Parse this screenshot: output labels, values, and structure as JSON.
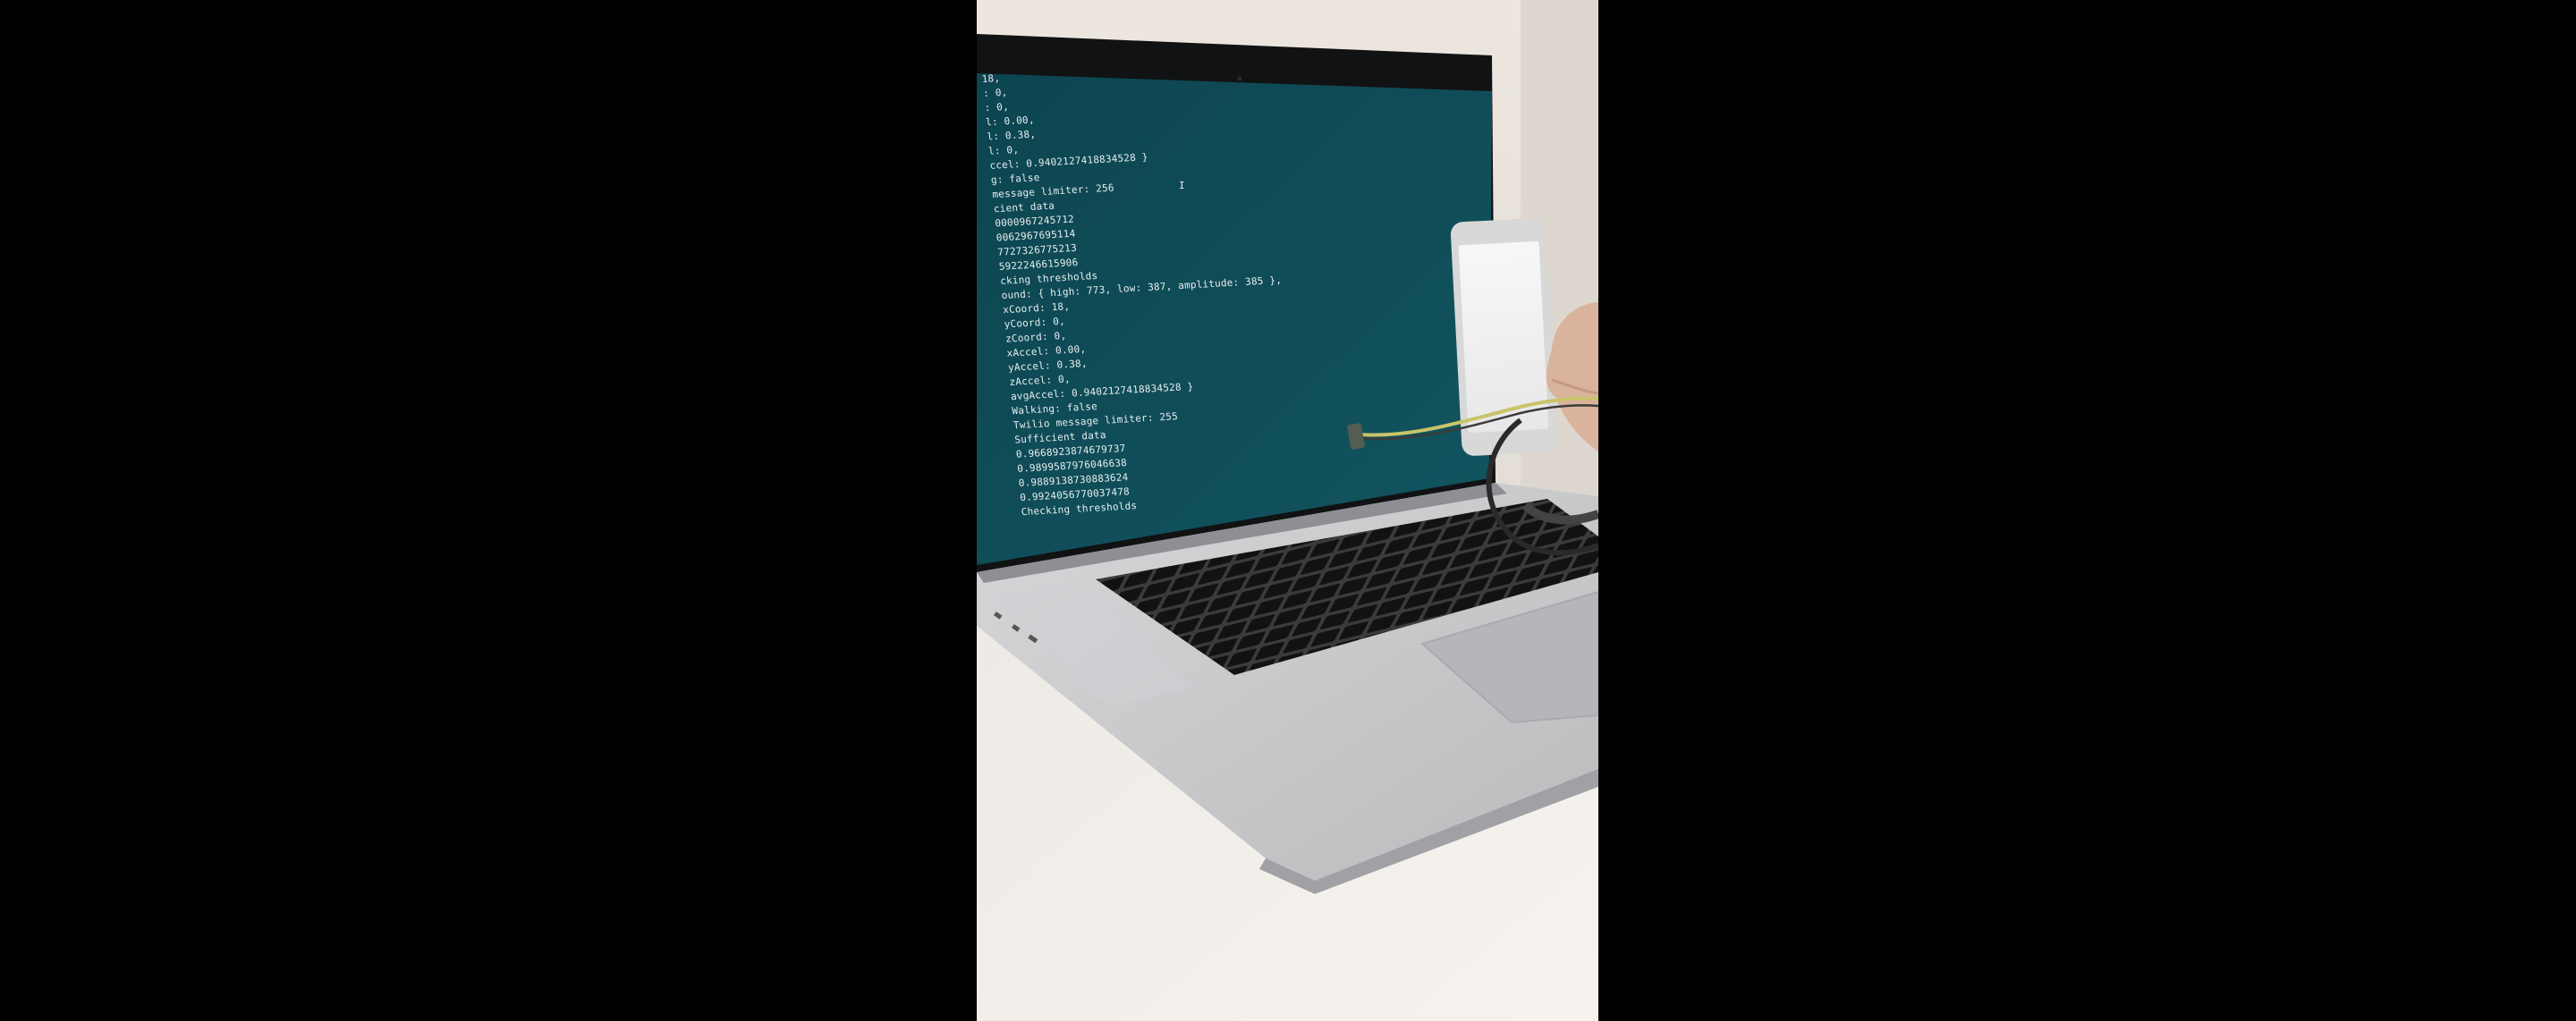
{
  "colors": {
    "letterbox": "#000000",
    "wall": "#e9e3dc",
    "desk": "#f1eeea",
    "terminal_bg": "#0f4a55",
    "terminal_text": "#e8eef0",
    "laptop_body": "#c9cbcd",
    "keys": "#151515",
    "wire": "#c9c46a"
  },
  "terminal": {
    "cursor": "I",
    "lines": [
      "  18,",
      ": 0,",
      ": 0,",
      "l: 0.00,",
      "l: 0.38,",
      "l: 0,",
      "ccel: 0.9402127418834528 }",
      "g: false",
      " message limiter: 256",
      "cient data",
      "0000967245712",
      "0062967695114",
      "7727326775213",
      "5922246615906",
      "cking thresholds",
      "ound: { high: 773, low: 387, amplitude: 385 },",
      "xCoord: 18,",
      "yCoord: 0,",
      "zCoord: 0,",
      "xAccel: 0.00,",
      "yAccel: 0.38,",
      "zAccel: 0,",
      "avgAccel: 0.9402127418834528 }",
      "Walking: false",
      "Twilio message limiter: 255",
      "Sufficient data",
      "0.9668923874679737",
      "0.9899587976046638",
      "0.9889138730883624",
      "0.9924056770037478",
      "Checking thresholds"
    ]
  }
}
